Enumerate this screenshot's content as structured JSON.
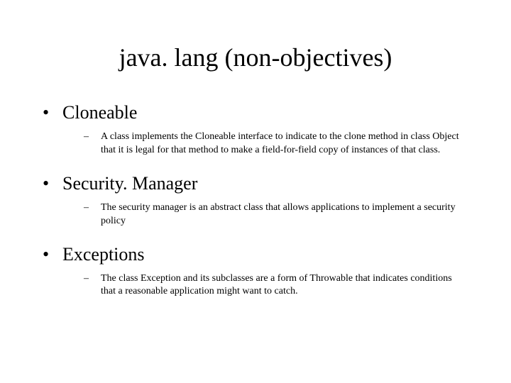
{
  "title": "java. lang (non-objectives)",
  "items": [
    {
      "label": "Cloneable",
      "sub": "A class implements the Cloneable interface to indicate to the clone method in class Object that it is legal for that method to make a field-for-field copy of instances of that class."
    },
    {
      "label": "Security. Manager",
      "sub": "The security manager is an abstract class that allows applications to implement a security policy"
    },
    {
      "label": "Exceptions",
      "sub": "The class Exception and its subclasses are a form of Throwable that indicates conditions that a reasonable application might want to catch."
    }
  ]
}
